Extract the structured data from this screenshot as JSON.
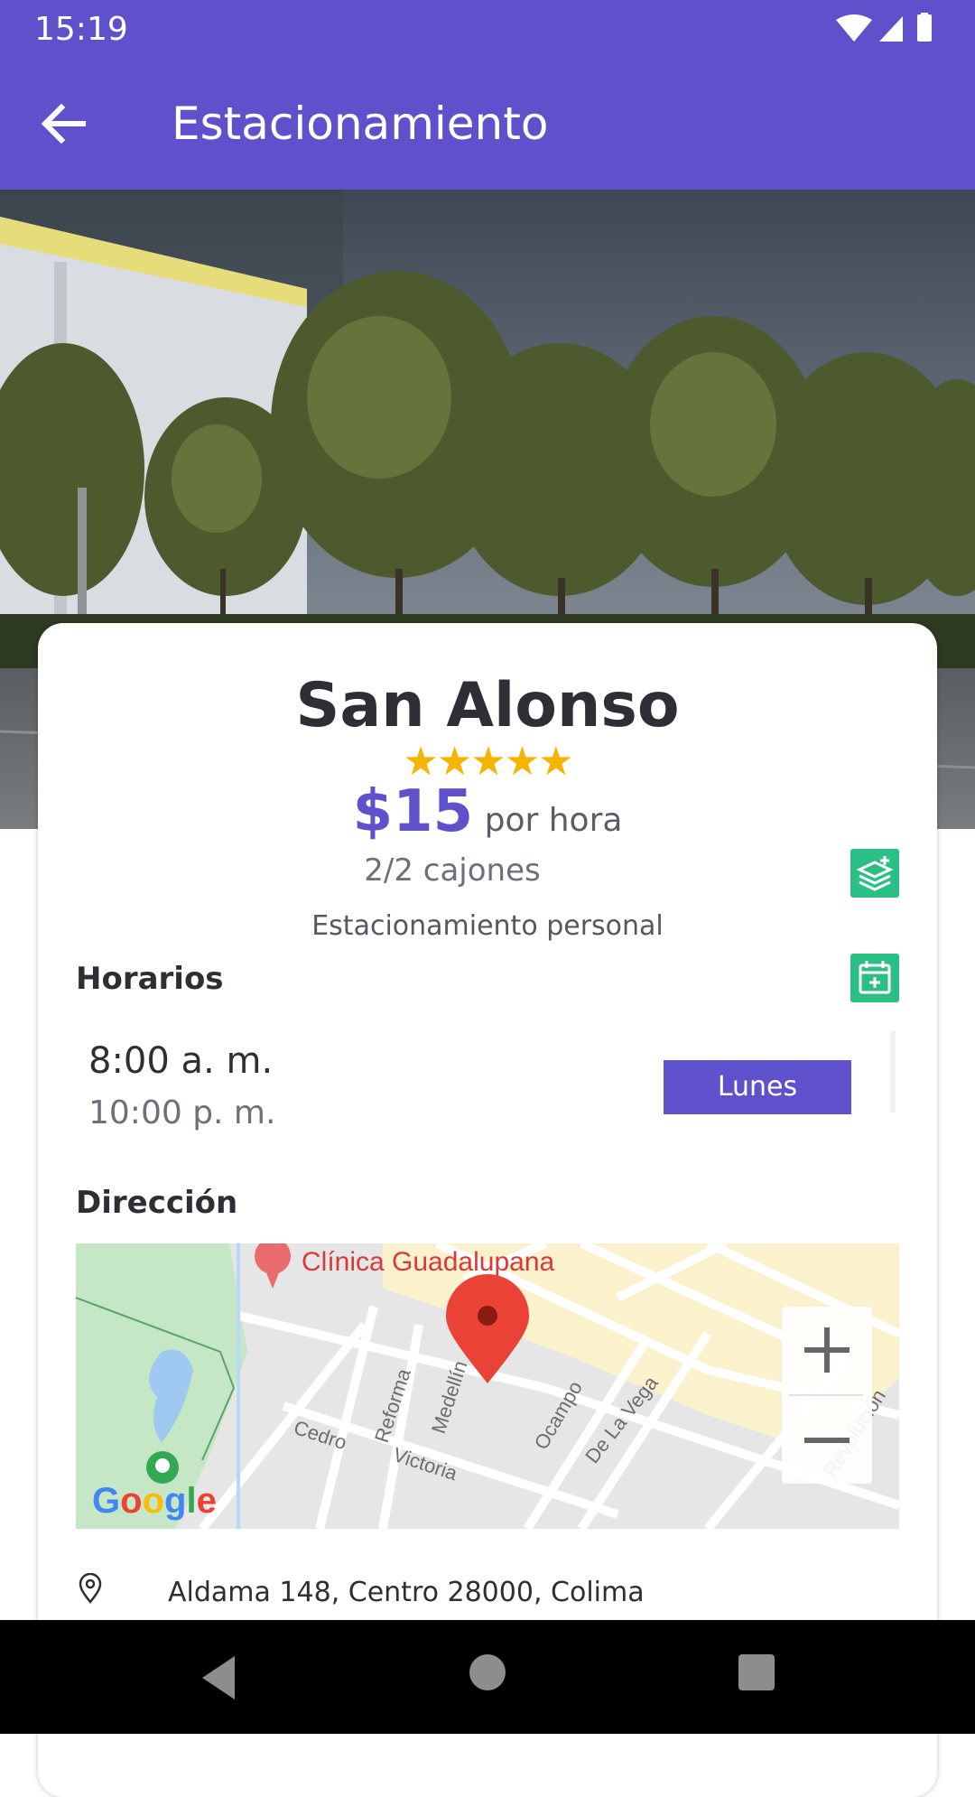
{
  "status_bar": {
    "time": "15:19"
  },
  "app_bar": {
    "title": "Estacionamiento"
  },
  "parking": {
    "name": "San Alonso",
    "rating_stars": "★★★★★",
    "rating": 5,
    "price": "$15",
    "price_unit": "por hora",
    "spaces": "2/2 cajones",
    "type": "Estacionamiento personal"
  },
  "schedule": {
    "heading": "Horarios",
    "open_time": "8:00 a. m.",
    "close_time": "10:00 p. m.",
    "day_button": "Lunes"
  },
  "address": {
    "heading": "Dirección",
    "text": "Aldama 148, Centro 28000, Colima"
  },
  "map": {
    "poi": "Clínica Guadalupana",
    "streets": [
      "Cedro",
      "Reforma",
      "Medellín",
      "Victoria",
      "Ocampo",
      "De La Vega",
      "Revolución"
    ],
    "attribution": "Google",
    "zoom_in": "+",
    "zoom_out": "−"
  },
  "colors": {
    "primary": "#5f51cc",
    "accent_green": "#2bbf86",
    "star": "#f5b400",
    "marker": "#ea4335"
  }
}
